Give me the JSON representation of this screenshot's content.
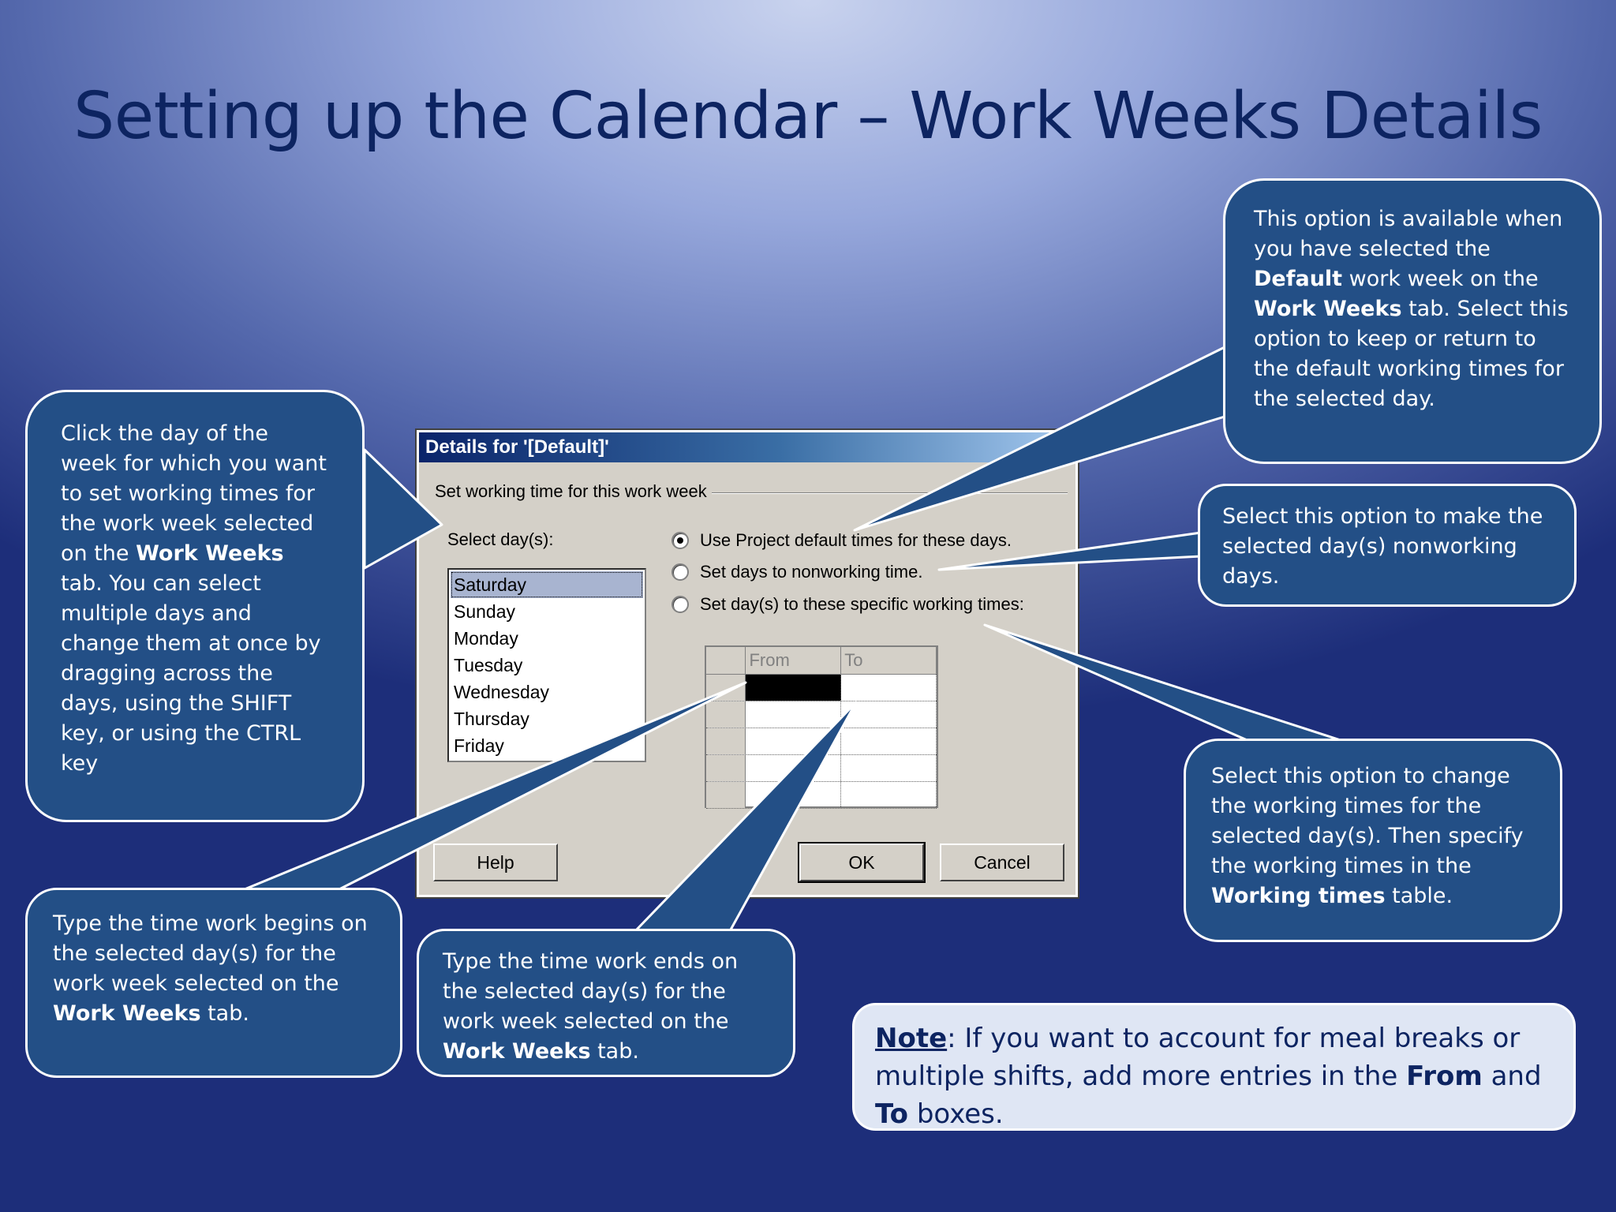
{
  "slide": {
    "title": "Setting up the Calendar – Work Weeks Details"
  },
  "dialog": {
    "title": "Details for '[Default]'",
    "group_label": "Set working time for this work week",
    "select_days_label": "Select day(s):",
    "days": [
      "Saturday",
      "Sunday",
      "Monday",
      "Tuesday",
      "Wednesday",
      "Thursday",
      "Friday"
    ],
    "selected_day": "Saturday",
    "options": [
      {
        "label": "Use Project default times for these days.",
        "checked": true
      },
      {
        "label": "Set days to nonworking time.",
        "checked": false
      },
      {
        "label": "Set day(s) to these specific working times:",
        "checked": false
      }
    ],
    "table": {
      "col_from": "From",
      "col_to": "To"
    },
    "buttons": {
      "help": "Help",
      "ok": "OK",
      "cancel": "Cancel"
    }
  },
  "callouts": {
    "top_right": {
      "t1": "This option is available when you have selected the ",
      "b1": "Default",
      "t2": " work week on the ",
      "b2": "Work Weeks",
      "t3": " tab. Select this option to keep or return to the default working times for the selected day."
    },
    "middle_right": {
      "t1": "Select this option to make the selected day(s) nonworking days."
    },
    "left": {
      "t1": "Click the day of the week for which you want to set working times for the work week selected on the ",
      "b1": "Work Weeks",
      "t2": " tab. You can select multiple days and change them at once by dragging across the days, using the SHIFT key, or using the CTRL key"
    },
    "bottom_left": {
      "t1": "Type the time work begins on the selected day(s) for the work week selected on the ",
      "b1": "Work Weeks",
      "t2": " tab."
    },
    "bottom_middle": {
      "t1": "Type the time work ends on the selected day(s) for the work week selected on the ",
      "b1": "Work Weeks",
      "t2": " tab."
    },
    "right_lower": {
      "t1": "Select this option to change the working times for the selected day(s). Then specify the working times in the ",
      "b1": "Working times",
      "t2": " table."
    }
  },
  "note": {
    "label": "Note",
    "t1": ": If you want to account for meal breaks or multiple shifts, add more entries in the ",
    "b1": "From",
    "t2": " and ",
    "b2": "To",
    "t3": " boxes."
  },
  "colors": {
    "callout_fill": "#234f86",
    "title_text": "#0d2461",
    "note_fill": "#dfe6f4"
  }
}
